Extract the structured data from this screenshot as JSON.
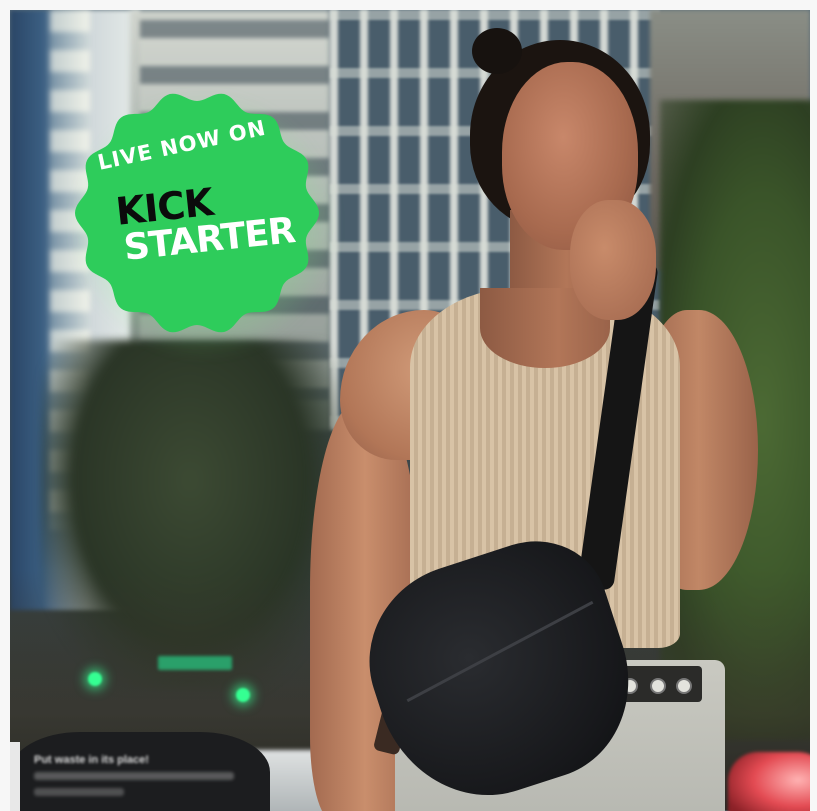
{
  "badge": {
    "line1": "LIVE NOW ON",
    "line2": "KICK",
    "line3": "STARTER",
    "fill_color": "#2ecc5b",
    "glow_color": "#78ff82"
  },
  "background_sign": {
    "text": "Put waste in its place!"
  },
  "colors": {
    "page_background": "#f7f7f7",
    "tank_top": "#d8c3a6",
    "bag": "#17181b",
    "traffic_light": "#35ff92"
  }
}
